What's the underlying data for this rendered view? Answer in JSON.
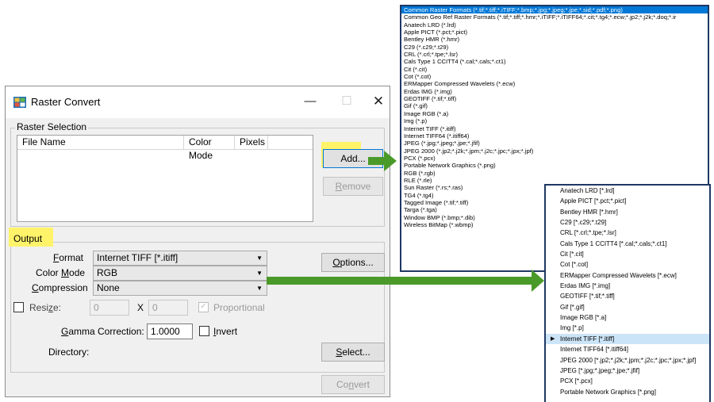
{
  "dialog": {
    "title": "Raster Convert",
    "minimize": "—",
    "maximize": "☐",
    "close": "✕",
    "raster_selection": {
      "label": "Raster Selection",
      "columns": [
        "File Name",
        "Color Mode",
        "Pixels"
      ],
      "add_label": "Add...",
      "remove_label": "Remove"
    },
    "output": {
      "label": "Output",
      "format_label": "Format",
      "format_value": "Internet TIFF [*.itiff]",
      "color_mode_label": "Color Mode",
      "color_mode_value": "RGB",
      "compression_label": "Compression",
      "compression_value": "None",
      "options_label": "Options...",
      "resize_label": "Resize:",
      "resize_w": "0",
      "resize_x": "X",
      "resize_h": "0",
      "proportional_label": "Proportional",
      "gamma_label": "Gamma Correction:",
      "gamma_value": "1.0000",
      "invert_label": "Invert",
      "directory_label": "Directory:",
      "select_label": "Select...",
      "convert_label": "Convert"
    }
  },
  "format_list_1": [
    "Common Raster Formats (*.tif;*.tiff;*.iTIFF;*.bmp;*.jpg;*.jpeg;*.jpe;*.sid;*.pdf;*.png)",
    "Common Geo Ref Raster Formats (*.tif;*.tiff;*.hmr;*.iTIFF;*.iTIFF64;*.cit;*.tg4;*.ecw;*.jp2;*.j2k;*.doq;*.ir",
    "Anatech LRD (*.lrd)",
    "Apple PICT (*.pct;*.pict)",
    "Bentley HMR (*.hmr)",
    "C29 (*.c29;*.t29)",
    "CRL (*.crl;*.tpe;*.lsr)",
    "Cals Type 1 CCITT4 (*.cal;*.cals;*.ct1)",
    "Cit (*.cit)",
    "Cot (*.cot)",
    "ERMapper Compressed Wavelets (*.ecw)",
    "Erdas IMG (*.img)",
    "GEOTIFF (*.tif;*.tiff)",
    "Gif (*.gif)",
    "Image RGB (*.a)",
    "Img (*.p)",
    "Internet TIFF (*.itiff)",
    "Internet TIFF64 (*.itiff64)",
    "JPEG (*.jpg;*.jpeg;*.jpe;*.jfif)",
    "JPEG 2000 (*.jp2;*.j2k;*.jpm;*.j2c;*.jpc;*.jpx;*.jpf)",
    "PCX (*.pcx)",
    "Portable Network Graphics (*.png)",
    "RGB (*.rgb)",
    "RLE (*.rle)",
    "Sun Raster (*.rs;*.ras)",
    "TG4 (*.tg4)",
    "Tagged Image (*.tif;*.tiff)",
    "Targa (*.tga)",
    "Window BMP (*.bmp;*.dib)",
    "Wireless BitMap (*.wbmp)"
  ],
  "format_list_2": [
    "Anatech LRD [*.lrd]",
    "Apple PICT [*.pct;*.pict]",
    "Bentley HMR [*.hmr]",
    "C29 [*.c29;*.t29]",
    "CRL [*.crl;*.tpe;*.lsr]",
    "Cals Type 1 CCITT4 [*.cal;*.cals;*.ct1]",
    "Cit [*.cit]",
    "Cot [*.cot]",
    "ERMapper Compressed Wavelets [*.ecw]",
    "Erdas IMG [*.img]",
    "GEOTIFF [*.tif;*.tiff]",
    "Gif [*.gif]",
    "Image RGB [*.a]",
    "Img [*.p]",
    "Internet TIFF [*.itiff]",
    "Internet TIFF64 [*.itiff64]",
    "JPEG 2000 [*.jp2;*.j2k;*.jpm;*.j2c;*.jpc;*.jpx;*.jpf]",
    "JPEG [*.jpg;*.jpeg;*.jpe;*.jfif]",
    "PCX [*.pcx]",
    "Portable Network Graphics [*.png]"
  ],
  "colors": {
    "highlight": "#fff36a",
    "arrow": "#4a9a2a",
    "selection": "#0078d7",
    "list_border": "#1f3864"
  }
}
